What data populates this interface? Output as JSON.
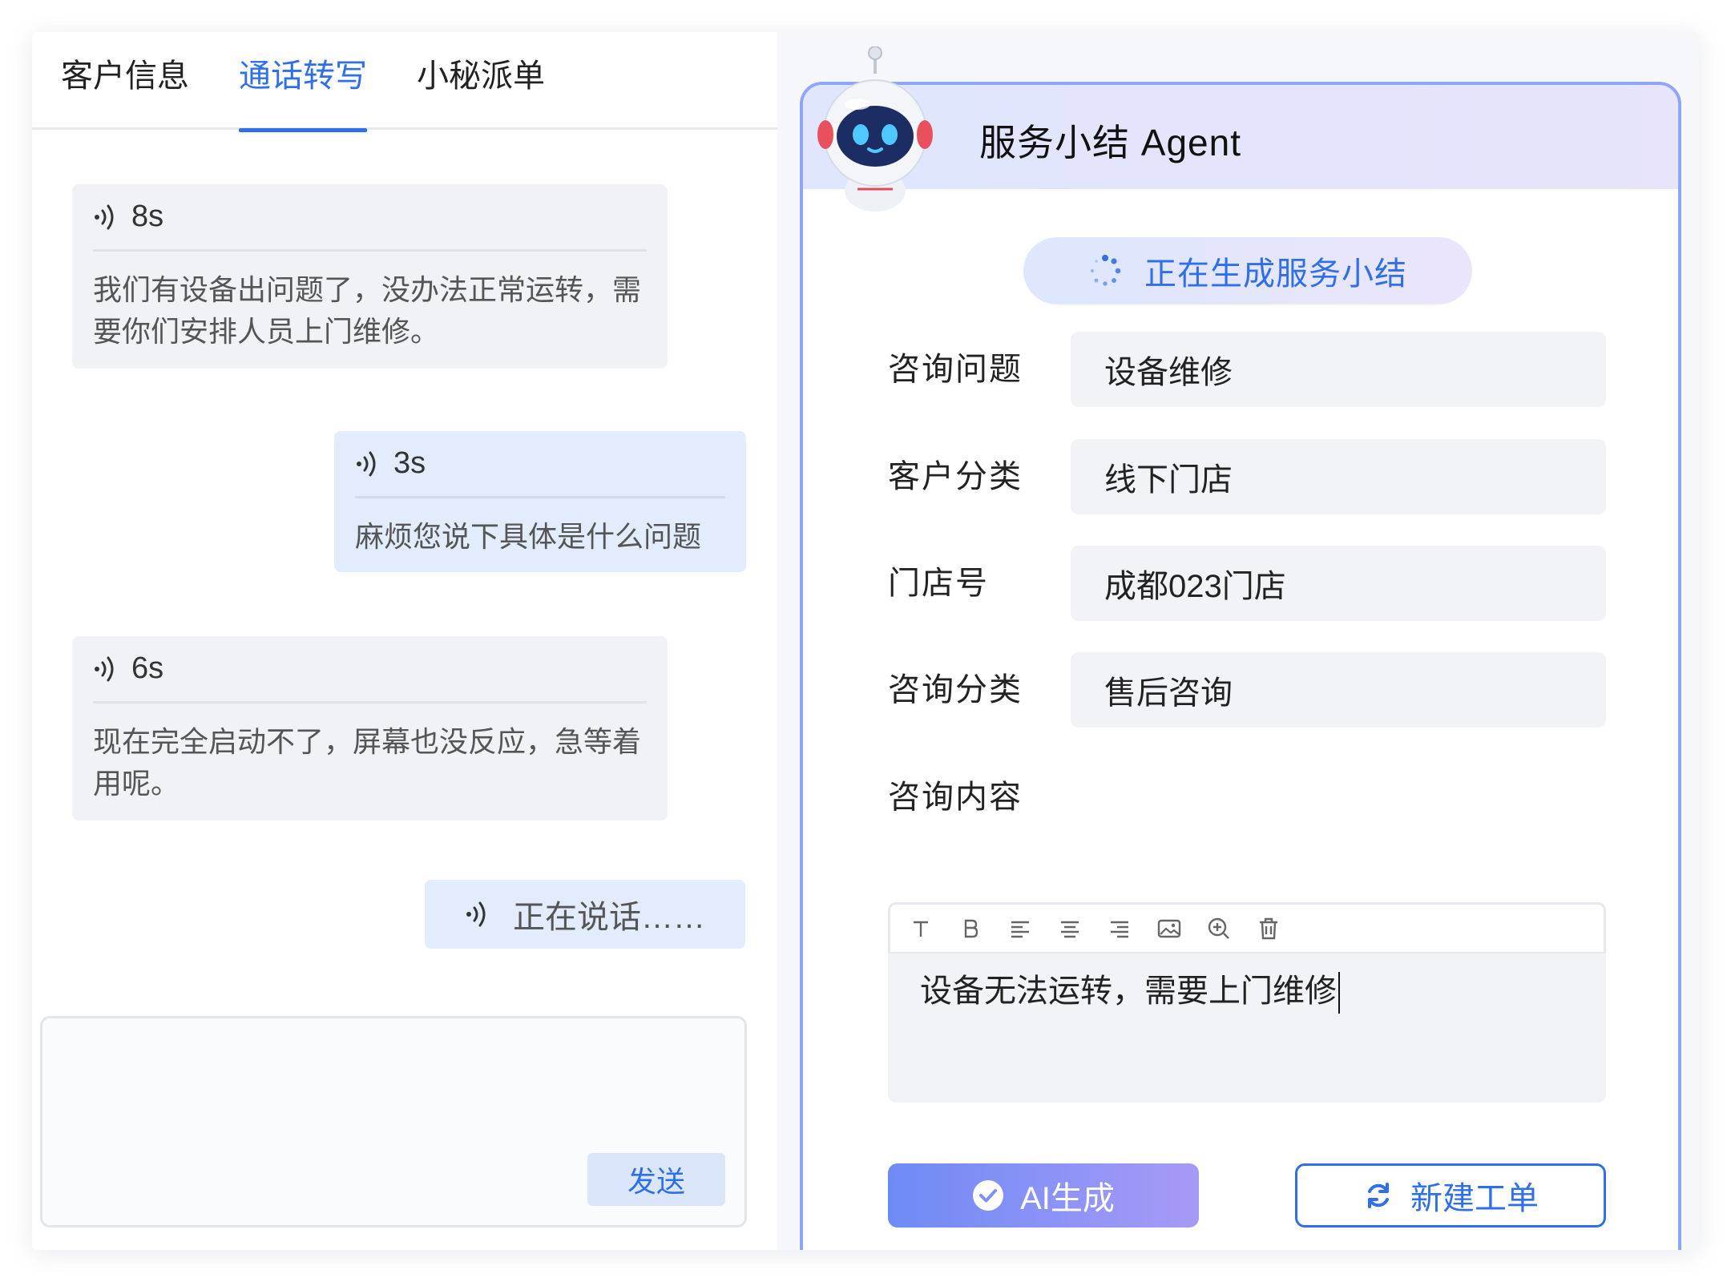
{
  "tabs": [
    {
      "label": "客户信息",
      "active": false
    },
    {
      "label": "通话转写",
      "active": true
    },
    {
      "label": "小秘派单",
      "active": false
    }
  ],
  "messages": [
    {
      "side": "in",
      "duration": "8s",
      "text": "我们有设备出问题了，没办法正常运转，需要你们安排人员上门维修。"
    },
    {
      "side": "out",
      "duration": "3s",
      "text": "麻烦您说下具体是什么问题"
    },
    {
      "side": "in",
      "duration": "6s",
      "text": "现在完全启动不了，屏幕也没反应，急等着用呢。"
    }
  ],
  "speaking_status": "正在说话……",
  "send_label": "发送",
  "agent": {
    "title": "服务小结 Agent",
    "generating_status": "正在生成服务小结",
    "fields": [
      {
        "label": "咨询问题",
        "value": "设备维修"
      },
      {
        "label": "客户分类",
        "value": "线下门店"
      },
      {
        "label": "门店号",
        "value": "成都023门店"
      },
      {
        "label": "咨询分类",
        "value": "售后咨询"
      }
    ],
    "content_label": "咨询内容",
    "content_text": "设备无法运转，需要上门维修",
    "toolbar_icons": [
      "text-icon",
      "bold-icon",
      "align-left-icon",
      "align-center-icon",
      "align-right-icon",
      "image-icon",
      "zoom-icon",
      "delete-icon"
    ],
    "ai_button": "AI生成",
    "new_ticket_button": "新建工单"
  },
  "colors": {
    "accent": "#2f6fe8",
    "bubble_in": "#f0f2f6",
    "bubble_out": "#e2ecfc",
    "card_border": "#8ea6f6"
  }
}
